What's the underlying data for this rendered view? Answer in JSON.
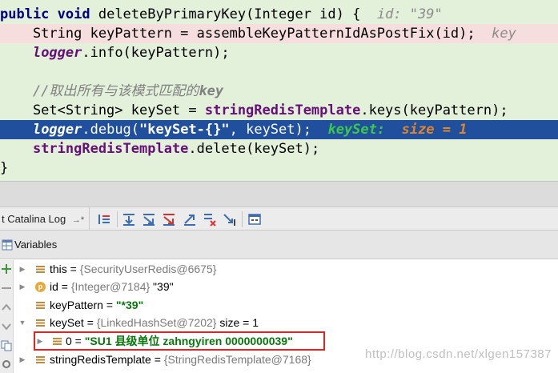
{
  "editor": {
    "lines": [
      {
        "t1": "public ",
        "t2": "void",
        "t3": " deleteByPrimaryKey(Integer id) {  ",
        "inline": "id: \"39\""
      },
      {
        "t1": "    String keyPattern = assembleKeyPatternIdAsPostFix(id);  ",
        "inline": "key"
      },
      {
        "logger": "logger",
        "rest": ".info(keyPattern);"
      },
      {
        "comment": "//取出所有与该模式匹配的",
        "comment_bold": "key"
      },
      {
        "t1": "    Set<String> keySet = ",
        "field": "stringRedisTemplate",
        "rest": ".keys(keyPattern);"
      },
      {
        "logger": "logger",
        "rest1": ".debug(",
        "str": "\"keySet-{}\"",
        "rest2": ", keySet);  ",
        "inl_name": "keySet:",
        "inl_val": "size = 1"
      },
      {
        "field": "stringRedisTemplate",
        "rest": ".delete(keySet);"
      },
      {
        "brace": "}"
      }
    ]
  },
  "log_tab": {
    "label": "t Catalina Log",
    "pin": "→*"
  },
  "toolbar": {
    "icons": [
      "show-execution-point-icon",
      "step-over-icon",
      "step-into-icon",
      "force-step-into-icon",
      "step-out-icon",
      "drop-frame-icon",
      "run-to-cursor-icon",
      "evaluate-expression-icon"
    ]
  },
  "variables": {
    "title": "Variables",
    "rows": [
      {
        "name": "this",
        "eq": " = ",
        "type": "{SecurityUserRedis@6675}",
        "value": "",
        "icon": "field-icon"
      },
      {
        "name": "id",
        "eq": " = ",
        "type": "{Integer@7184}",
        "value": " \"39\"",
        "icon": "parameter-icon",
        "icon_letter": "p"
      },
      {
        "name": "keyPattern",
        "eq": " = ",
        "type": "",
        "value": "\"*39\"",
        "icon": "field-icon"
      },
      {
        "name": "keySet",
        "eq": " = ",
        "type": "{LinkedHashSet@7202}",
        "value": "  size = 1",
        "icon": "field-icon"
      },
      {
        "name": "0",
        "eq": " = ",
        "type": "",
        "value": "\"SU1  县级单位  zahngyiren  0000000039\"",
        "icon": "field-icon"
      },
      {
        "name": "stringRedisTemplate",
        "eq": " = ",
        "type": "{StringRedisTemplate@7168}",
        "value": "",
        "icon": "field-icon"
      }
    ]
  },
  "watermark": "http://blog.csdn.net/xlgen157387",
  "colors": {
    "editor_bg": "#e3f0da",
    "current_line": "#1f4f9d",
    "breakpoint_line": "#f7dede",
    "string_green": "#08780a",
    "highlight_box": "#e32222"
  }
}
